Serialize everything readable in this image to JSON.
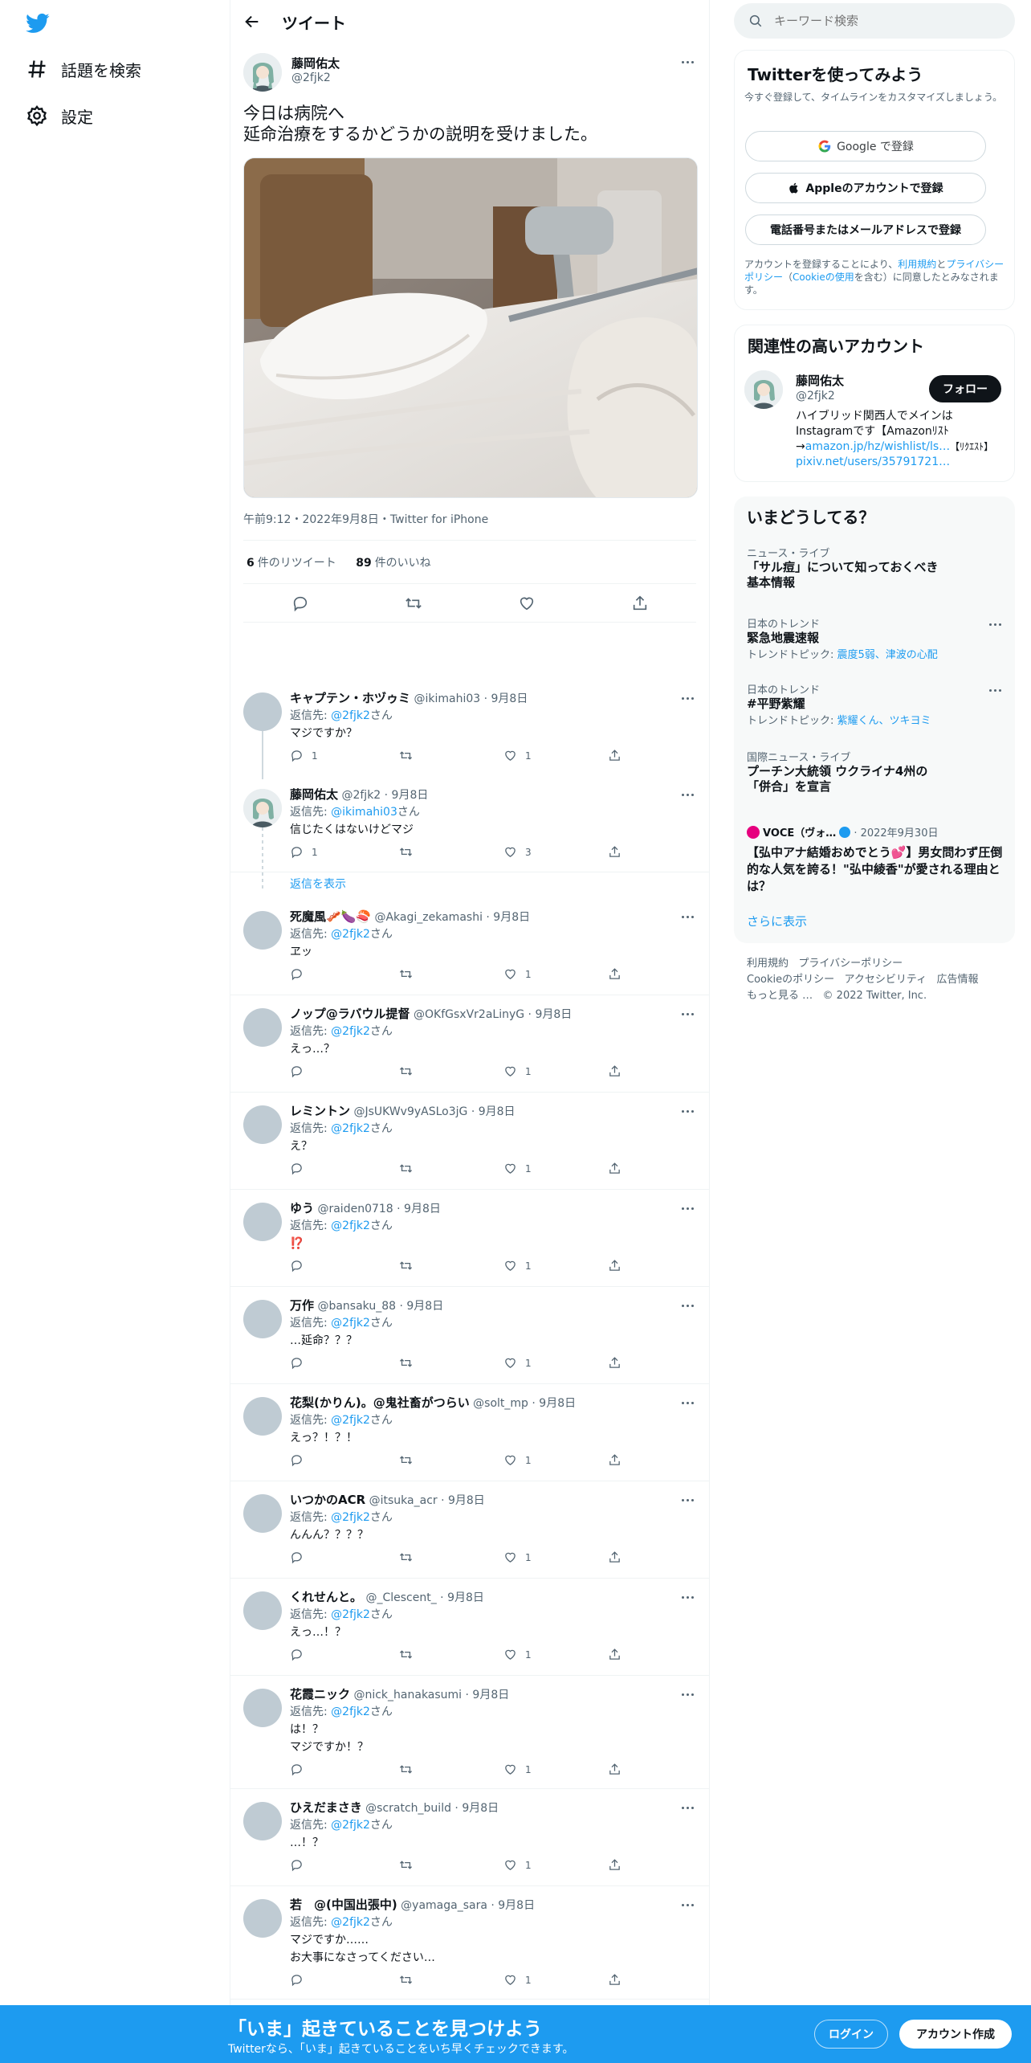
{
  "nav": {
    "explore_label": "話題を検索",
    "settings_label": "設定"
  },
  "header": {
    "title": "ツイート"
  },
  "tweet": {
    "name": "藤岡佑太",
    "handle": "@2fjk2",
    "text": "今日は病院へ\n延命治療をするかどうかの説明を受けました。",
    "meta": "午前9:12・2022年9月8日・Twitter for iPhone",
    "retweets": "6",
    "retweets_label": "件のリツイート",
    "likes": "89",
    "likes_label": "件のいいね"
  },
  "replies": [
    {
      "name": "キャプテン・ホヅゥミ",
      "handle": "@ikimahi03 · 9月8日",
      "reply_to_label": "返信先: ",
      "reply_to": "@2fjk2",
      "reply_to_suffix": "さん",
      "text": "マジですか？",
      "reply_count": "1",
      "like_count": "1",
      "avatar": "gray"
    },
    {
      "name": "藤岡佑太",
      "handle": "@2fjk2 · 9月8日",
      "reply_to_label": "返信先: ",
      "reply_to": "@ikimahi03",
      "reply_to_suffix": "さん",
      "text": "信じたくはないけどマジ",
      "reply_count": "1",
      "like_count": "3",
      "avatar": "photo"
    },
    {
      "name": "死魔風🥓🍆🍣",
      "handle": "@Akagi_zekamashi · 9月8日",
      "reply_to_label": "返信先: ",
      "reply_to": "@2fjk2",
      "reply_to_suffix": "さん",
      "text": "ヱッ",
      "reply_count": "",
      "like_count": "1",
      "avatar": "gray"
    },
    {
      "name": "ノップ@ラバウル提督",
      "handle": "@OKfGsxVr2aLinyG · 9月8日",
      "reply_to_label": "返信先: ",
      "reply_to": "@2fjk2",
      "reply_to_suffix": "さん",
      "text": "えっ…？",
      "reply_count": "",
      "like_count": "1",
      "avatar": "gray"
    },
    {
      "name": "レミントン",
      "handle": "@JsUKWv9yASLo3jG · 9月8日",
      "reply_to_label": "返信先: ",
      "reply_to": "@2fjk2",
      "reply_to_suffix": "さん",
      "text": "え？",
      "reply_count": "",
      "like_count": "1",
      "avatar": "gray"
    },
    {
      "name": "ゆう",
      "handle": "@raiden0718 · 9月8日",
      "reply_to_label": "返信先: ",
      "reply_to": "@2fjk2",
      "reply_to_suffix": "さん",
      "text": "⁉️",
      "reply_count": "",
      "like_count": "1",
      "avatar": "gray"
    },
    {
      "name": "万作",
      "handle": "@bansaku_88 · 9月8日",
      "reply_to_label": "返信先: ",
      "reply_to": "@2fjk2",
      "reply_to_suffix": "さん",
      "text": "…延命？？？",
      "reply_count": "",
      "like_count": "1",
      "avatar": "gray"
    },
    {
      "name": "花梨(かりん)。@鬼社畜がつらい",
      "handle": "@solt_mp · 9月8日",
      "reply_to_label": "返信先: ",
      "reply_to": "@2fjk2",
      "reply_to_suffix": "さん",
      "text": "えっ？！？！",
      "reply_count": "",
      "like_count": "1",
      "avatar": "gray"
    },
    {
      "name": "いつかのACR",
      "handle": "@itsuka_acr · 9月8日",
      "reply_to_label": "返信先: ",
      "reply_to": "@2fjk2",
      "reply_to_suffix": "さん",
      "text": "んんん？？？？",
      "reply_count": "",
      "like_count": "1",
      "avatar": "gray"
    },
    {
      "name": "くれせんと。",
      "handle": "@_Clescent_ · 9月8日",
      "reply_to_label": "返信先: ",
      "reply_to": "@2fjk2",
      "reply_to_suffix": "さん",
      "text": "えっ…！？",
      "reply_count": "",
      "like_count": "1",
      "avatar": "gray"
    },
    {
      "name": "花霞ニック",
      "handle": "@nick_hanakasumi · 9月8日",
      "reply_to_label": "返信先: ",
      "reply_to": "@2fjk2",
      "reply_to_suffix": "さん",
      "text": "は！？\nマジですか！？",
      "reply_count": "",
      "like_count": "1",
      "avatar": "gray"
    },
    {
      "name": "ひえだまさき",
      "handle": "@scratch_build · 9月8日",
      "reply_to_label": "返信先: ",
      "reply_to": "@2fjk2",
      "reply_to_suffix": "さん",
      "text": "…！？",
      "reply_count": "",
      "like_count": "1",
      "avatar": "gray"
    },
    {
      "name": "若　@(中国出張中)",
      "handle": "@yamaga_sara · 9月8日",
      "reply_to_label": "返信先: ",
      "reply_to": "@2fjk2",
      "reply_to_suffix": "さん",
      "text": "マジですか……\nお大事になさってください…",
      "reply_count": "",
      "like_count": "1",
      "avatar": "gray"
    }
  ],
  "show_thread": "返信を表示",
  "search": {
    "placeholder": "キーワード検索"
  },
  "signup_card": {
    "title": "Twitterを使ってみよう",
    "subtitle": "今すぐ登録して、タイムラインをカスタマイズしましょう。",
    "google": "Google で登録",
    "apple": "Appleのアカウントで登録",
    "phone": "電話番号またはメールアドレスで登録",
    "terms_prefix": "アカウントを登録することにより、",
    "terms_link": "利用規約",
    "terms_and": "と",
    "privacy_link": "プライバシーポリシー",
    "cookie_open": "（",
    "cookie_link": "Cookieの使用",
    "terms_suffix": "を含む）に同意したとみなされます。"
  },
  "related": {
    "title": "関連性の高いアカウント",
    "name": "藤岡佑太",
    "handle": "@2fjk2",
    "follow": "フォロー",
    "bio_1": "ハイブリッド関西人でメインはInstagramです【Amazonﾘｽﾄ→",
    "bio_link1": "amazon.jp/hz/wishlist/ls…",
    "bio_2": "【ﾘｸｴｽﾄ】",
    "bio_link2": "pixiv.net/users/35791721…"
  },
  "trends": {
    "title": "いまどうしてる？",
    "items": [
      {
        "cat": "ニュース・ライブ",
        "title": "「サル痘」について知っておくべき基本情報",
        "sub_prefix": "",
        "sub_link": ""
      },
      {
        "cat": "日本のトレンド",
        "title": "緊急地震速報",
        "sub_prefix": "トレンドトピック: ",
        "sub_link": "震度5弱、津波の心配"
      },
      {
        "cat": "日本のトレンド",
        "title": "#平野紫耀",
        "sub_prefix": "トレンドトピック: ",
        "sub_link": "紫耀くん、ツキヨミ"
      },
      {
        "cat": "国際ニュース・ライブ",
        "title": "プーチン大統領 ウクライナ4州の「併合」を宣言",
        "sub_prefix": "",
        "sub_link": ""
      }
    ],
    "voce_name": "VOCE（ヴォ…",
    "voce_date": "· 2022年9月30日",
    "voce_title": "【弘中アナ結婚おめでとう💕】男女問わず圧倒的な人気を誇る！\"弘中綾香\"が愛される理由とは？",
    "show_more": "さらに表示"
  },
  "footer": {
    "l1": "利用規約",
    "l2": "プライバシーポリシー",
    "l3": "Cookieのポリシー",
    "l4": "アクセシビリティ",
    "l5": "広告情報",
    "l6": "もっと見る …",
    "copyright": "© 2022 Twitter, Inc."
  },
  "bottom": {
    "title": "「いま」起きていることを見つけよう",
    "subtitle": "Twitterなら、「いま」起きていることをいち早くチェックできます。",
    "login": "ログイン",
    "signup": "アカウント作成"
  },
  "colors": {
    "brand": "#1d9bf0",
    "text": "#0f1419",
    "muted": "#536471"
  }
}
